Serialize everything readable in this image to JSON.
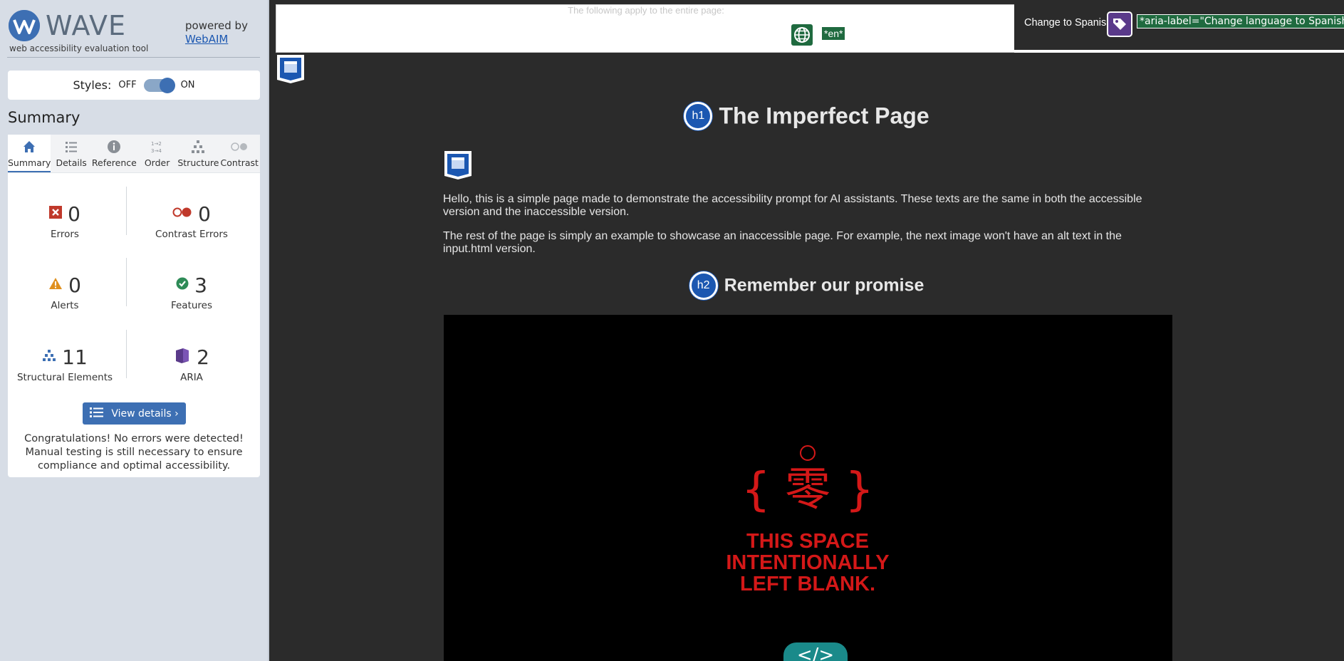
{
  "sidebar": {
    "logo": {
      "word": "WAVE",
      "tagline": "web accessibility evaluation tool"
    },
    "powered_by": "powered by",
    "powered_link": "WebAIM",
    "styles": {
      "label": "Styles:",
      "off": "OFF",
      "on": "ON",
      "state": "on"
    },
    "summary_heading": "Summary",
    "tabs": [
      {
        "label": "Summary",
        "icon": "home-icon",
        "active": true
      },
      {
        "label": "Details",
        "icon": "list-icon"
      },
      {
        "label": "Reference",
        "icon": "info-icon"
      },
      {
        "label": "Order",
        "icon": "order-icon"
      },
      {
        "label": "Structure",
        "icon": "structure-icon"
      },
      {
        "label": "Contrast",
        "icon": "contrast-icon"
      }
    ],
    "stats": {
      "errors": {
        "count": "0",
        "label": "Errors",
        "color": "#c0392b"
      },
      "contrast_errors": {
        "count": "0",
        "label": "Contrast Errors",
        "color": "#c0392b"
      },
      "alerts": {
        "count": "0",
        "label": "Alerts",
        "color": "#e0901e"
      },
      "features": {
        "count": "3",
        "label": "Features",
        "color": "#2e8b57"
      },
      "structural": {
        "count": "11",
        "label": "Structural Elements",
        "color": "#3d6fb3"
      },
      "aria": {
        "count": "2",
        "label": "ARIA",
        "color": "#5a3a8a"
      }
    },
    "view_details": "View details ›",
    "congrats": "Congratulations! No errors were detected! Manual testing is still necessary to ensure compliance and optimal accessibility."
  },
  "main": {
    "topbar": {
      "apply_text": "The following apply to the entire page:",
      "lang_value": "*en*"
    },
    "spanish": {
      "text": "Change to Spanish",
      "aria_label": "*aria-label=\"Change language to Spanish\"*"
    },
    "h1": {
      "badge": "h1",
      "text": "The Imperfect Page"
    },
    "paragraphs": [
      "Hello, this is a simple page made to demonstrate the accessibility prompt for AI assistants. These texts are the same in both the accessible version and the inaccessible version.",
      "The rest of the page is simply an example to showcase an inaccessible page. For example, the next image won't have an alt text in the input.html version."
    ],
    "h2": {
      "badge": "h2",
      "text": "Remember our promise"
    },
    "image": {
      "kanji": "{ 零 }",
      "line1": "THIS SPACE",
      "line2": "INTENTIONALLY",
      "line3": "LEFT BLANK."
    },
    "code_badge": "</>"
  },
  "colors": {
    "accent": "#3d6fb3",
    "sidebar_bg": "#d7dde6",
    "page_bg": "#2b2b2b",
    "wave_green": "#1f6a3f",
    "image_red": "#d41818"
  }
}
